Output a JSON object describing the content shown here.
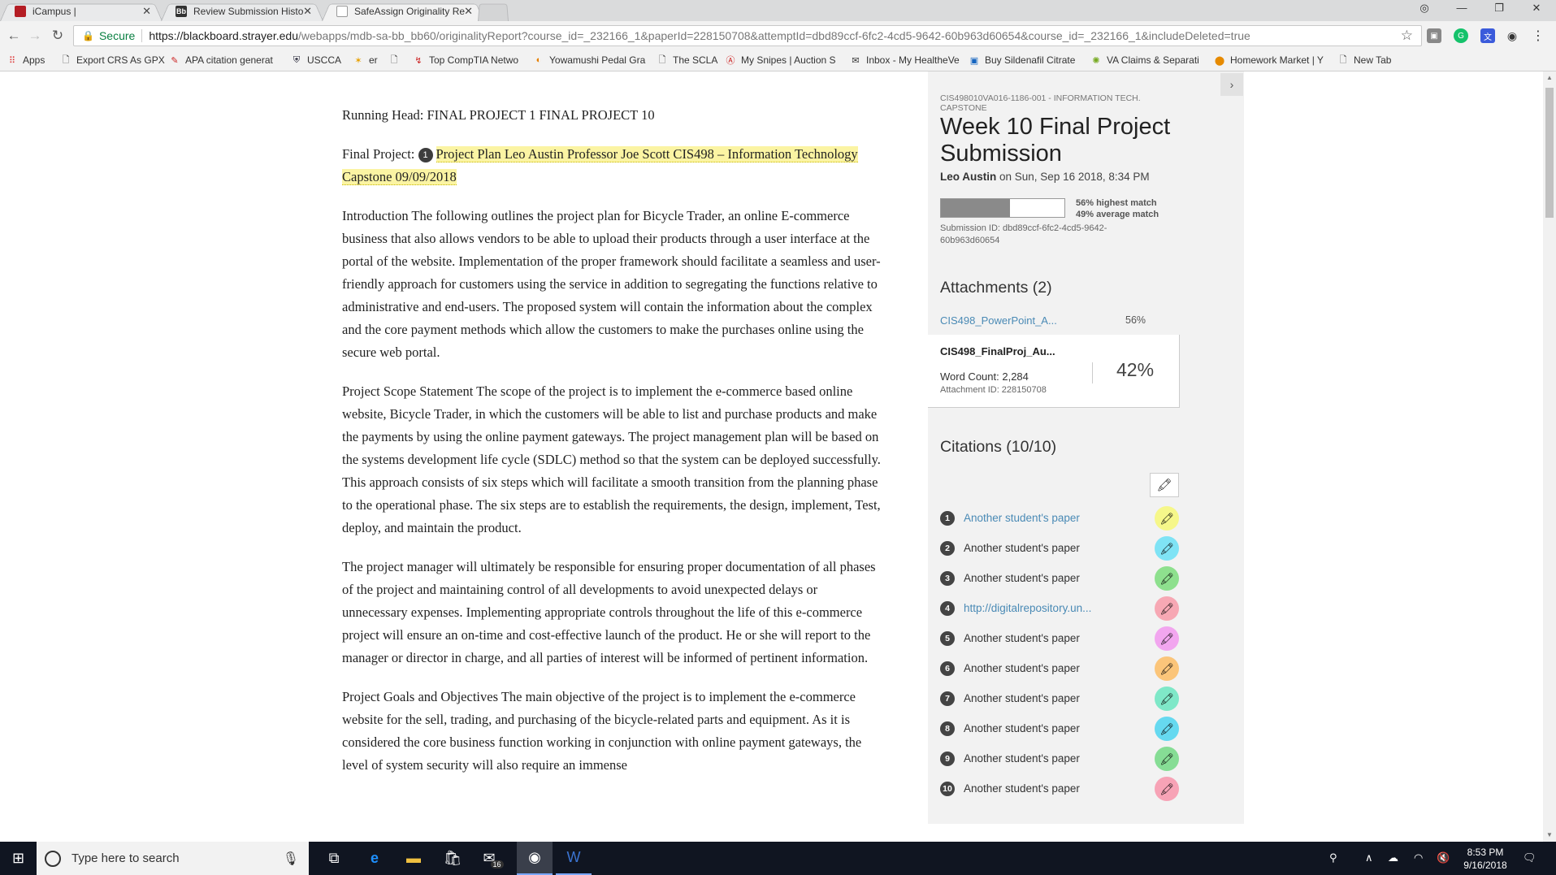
{
  "browser": {
    "tabs": [
      {
        "label": "iCampus |",
        "favicon_color": "#b41d24",
        "favicon_text": "",
        "active": false
      },
      {
        "label": "Review Submission Histo",
        "favicon_color": "#333333",
        "favicon_text": "Bb",
        "active": false
      },
      {
        "label": "SafeAssign Originality Re",
        "favicon_color": "#ffffff",
        "favicon_text": "",
        "active": true
      }
    ],
    "secure_label": "Secure",
    "url_host": "https://blackboard.strayer.edu",
    "url_rest": "/webapps/mdb-sa-bb_bb60/originalityReport?course_id=_232166_1&paperId=228150708&attemptId=dbd89ccf-6fc2-4cd5-9642-60b963d60654&course_id=_232166_1&includeDeleted=true",
    "bookmarks": [
      {
        "label": "Apps",
        "icon": "apps-grid-icon"
      },
      {
        "label": "Export CRS As GPX",
        "icon": "page-icon"
      },
      {
        "label": "APA citation generat",
        "icon": "apa-icon"
      },
      {
        "label": "USCCA",
        "icon": "uscca-icon"
      },
      {
        "label": "er",
        "icon": "er-icon"
      },
      {
        "label": "",
        "icon": "page-icon"
      },
      {
        "label": "Top CompTIA Netwo",
        "icon": "comptia-icon"
      },
      {
        "label": "Yowamushi Pedal Gra",
        "icon": "yowamushi-icon"
      },
      {
        "label": "The SCLA",
        "icon": "page-icon"
      },
      {
        "label": "My Snipes | Auction S",
        "icon": "snipes-icon"
      },
      {
        "label": "Inbox - My HealtheVe",
        "icon": "mail-icon"
      },
      {
        "label": "Buy Sildenafil Citrate",
        "icon": "pharmacy-icon"
      },
      {
        "label": "VA Claims & Separati",
        "icon": "va-icon"
      },
      {
        "label": "Homework Market | Y",
        "icon": "homework-icon"
      },
      {
        "label": "New Tab",
        "icon": "page-icon"
      }
    ]
  },
  "paper": {
    "running_head": "Running Head: FINAL PROJECT 1 FINAL PROJECT 10",
    "final_project_label": "Final Project:",
    "citation_number": "1",
    "highlighted_text": "Project Plan Leo Austin Professor Joe Scott CIS498 – Information Technology Capstone 09/09/2018",
    "paragraphs": [
      "Introduction The following outlines the project plan for Bicycle Trader, an online E-commerce business that also allows vendors to be able to upload their products through a user interface at the portal of the website. Implementation of the proper framework should facilitate a seamless and user-friendly approach for customers using the service in addition to segregating the functions relative to administrative and end-users. The proposed system will contain the information about the complex and the core payment methods which allow the customers to make the purchases online using the secure web portal.",
      "Project Scope Statement The scope of the project is to implement the e-commerce based online website, Bicycle Trader, in which the customers will be able to list and purchase products and make the payments by using the online payment gateways. The project management plan will be based on the systems development life cycle (SDLC) method so that the system can be deployed successfully. This approach consists of six steps which will facilitate a smooth transition from the planning phase to the operational phase. The six steps are to establish the requirements, the design, implement, Test, deploy, and maintain the product.",
      "The project manager will ultimately be responsible for ensuring proper documentation of all phases of the project and maintaining control of all developments to avoid unexpected delays or unnecessary expenses. Implementing appropriate controls throughout the life of this e-commerce project will ensure an on-time and cost-effective launch of the product. He or she will report to the manager or director in charge, and all parties of interest will be informed of pertinent information.",
      "Project Goals and Objectives The main objective of the project is to implement the e-commerce website for the sell, trading, and purchasing of the bicycle-related parts and equipment. As it is considered the core business function working in conjunction with online payment gateways, the level of system security will also require an immense"
    ]
  },
  "panel": {
    "course": "CIS498010VA016-1186-001 - INFORMATION TECH. CAPSTONE",
    "title": "Week 10 Final Project Submission",
    "author": "Leo Austin",
    "submitted_on": "on Sun, Sep 16 2018, 8:34 PM",
    "highest_match_fraction": 0.56,
    "highest_match_label": "56% highest match",
    "average_match_label": "49% average match",
    "submission_id": "Submission ID: dbd89ccf-6fc2-4cd5-9642-60b963d60654",
    "attachments_heading": "Attachments (2)",
    "attachments": [
      {
        "name": "CIS498_PowerPoint_A...",
        "percent": "56%"
      },
      {
        "name": "CIS498_FinalProj_Au...",
        "word_count": "Word Count: 2,284",
        "attachment_id": "Attachment ID: 228150708",
        "percent": "42%"
      }
    ],
    "citations_heading": "Citations (10/10)",
    "citations": [
      {
        "num": "1",
        "text": "Another student's paper",
        "color": "#f6f78a",
        "link": true
      },
      {
        "num": "2",
        "text": "Another student's paper",
        "color": "#7fe3f5",
        "link": false
      },
      {
        "num": "3",
        "text": "Another student's paper",
        "color": "#8ee08e",
        "link": false
      },
      {
        "num": "4",
        "text": "http://digitalrepository.un...",
        "color": "#f7a8b4",
        "link": true
      },
      {
        "num": "5",
        "text": "Another student's paper",
        "color": "#f2a6ef",
        "link": false
      },
      {
        "num": "6",
        "text": "Another student's paper",
        "color": "#fbc57a",
        "link": false
      },
      {
        "num": "7",
        "text": "Another student's paper",
        "color": "#7fe8c8",
        "link": false
      },
      {
        "num": "8",
        "text": "Another student's paper",
        "color": "#66d9f0",
        "link": false
      },
      {
        "num": "9",
        "text": "Another student's paper",
        "color": "#86dd95",
        "link": false
      },
      {
        "num": "10",
        "text": "Another student's paper",
        "color": "#f7a3b6",
        "link": false
      }
    ]
  },
  "taskbar": {
    "search_placeholder": "Type here to search",
    "mail_badge": "16",
    "time": "8:53 PM",
    "date": "9/16/2018"
  }
}
